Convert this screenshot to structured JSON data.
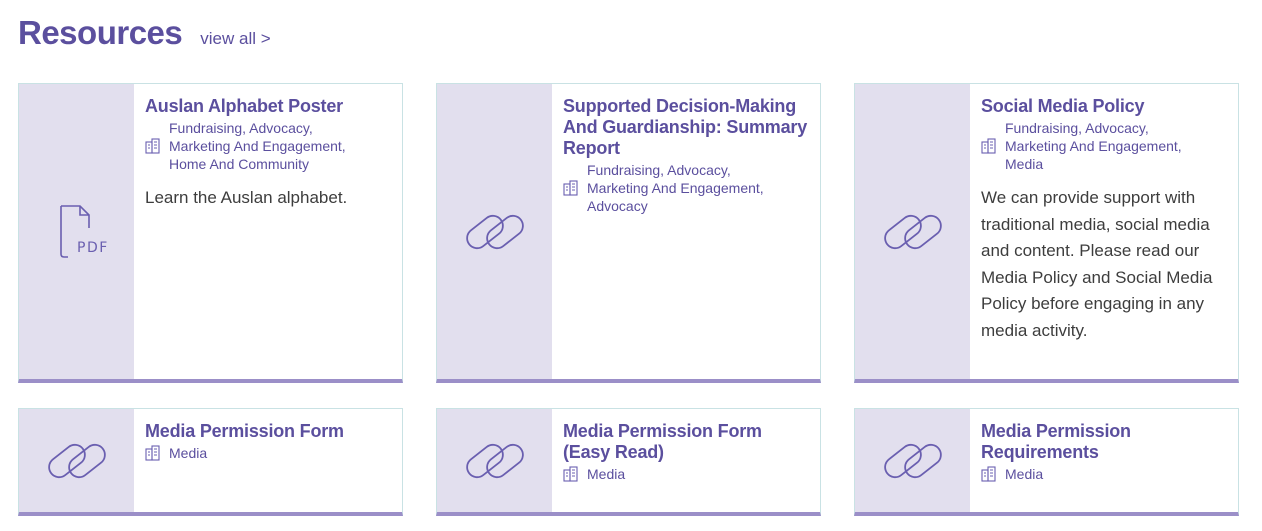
{
  "header": {
    "title": "Resources",
    "view_all": "view all >"
  },
  "cards": [
    {
      "title": "Auslan Alphabet Poster",
      "tags": [
        "Fundraising, Advocacy,",
        "Marketing And Engagement,",
        "Home And Community"
      ],
      "description": "Learn the Auslan alphabet.",
      "icon": "pdf-file-icon"
    },
    {
      "title": "Supported Decision-Making And Guardianship: Summary Report",
      "tags": [
        "Fundraising, Advocacy,",
        "Marketing And Engagement,",
        "Advocacy"
      ],
      "description": "",
      "icon": "link-icon"
    },
    {
      "title": "Social Media Policy",
      "tags": [
        "Fundraising, Advocacy,",
        "Marketing And Engagement,",
        "Media"
      ],
      "description": "We can provide support with traditional media, social media and content. Please read our Media Policy and Social Media Policy before engaging in any media activity.",
      "icon": "link-icon"
    },
    {
      "title": "Media Permission Form",
      "tags": [
        "Media"
      ],
      "description": "",
      "icon": "link-icon"
    },
    {
      "title": "Media Permission Form (Easy Read)",
      "tags": [
        "Media"
      ],
      "description": "",
      "icon": "link-icon"
    },
    {
      "title": "Media Permission Requirements",
      "tags": [
        "Media"
      ],
      "description": "",
      "icon": "link-icon"
    }
  ],
  "colors": {
    "accent": "#5b4f9e",
    "thumb_bg": "#e2dfee",
    "card_bottom": "#9b8fc8",
    "card_border": "#c9e2e4"
  }
}
